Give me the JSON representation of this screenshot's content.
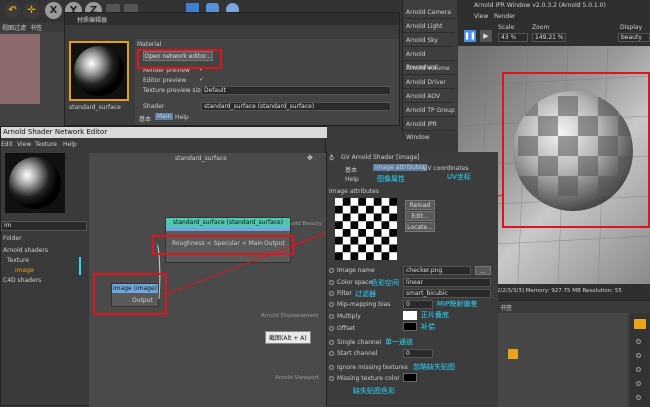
{
  "top_toolbar": {
    "icons": [
      "undo-icon",
      "move-icon",
      "scale-icon",
      "x-axis-icon",
      "y-axis-icon",
      "z-axis-icon",
      "coord-icon"
    ],
    "x_label": "X",
    "y_label": "Y",
    "z_label": "Z"
  },
  "left_menu": {
    "items": [
      "视图",
      "过滤",
      "书签"
    ]
  },
  "material_editor": {
    "title": "材质编辑器",
    "section": "Material",
    "open_network_editor": "Open network editor...",
    "render_preview": "Render preview",
    "editor_preview": "Editor preview",
    "texture_preview_size_label": "Texture preview size",
    "texture_preview_size_value": "Default",
    "material_name": "standard_surface",
    "shader_label": "Shader",
    "shader_value": "standard_surface (standard_surface)",
    "tabs": [
      "基本",
      "Main",
      "Help"
    ]
  },
  "network_editor": {
    "title": "Arnold Shader Network Editor",
    "menus": [
      "Edit",
      "View",
      "Texture",
      "Help"
    ],
    "search_value": "im",
    "list_header": "Folder",
    "tree": [
      "Arnold shaders",
      "Texture",
      "image",
      "C4D shaders"
    ],
    "canvas_title": "standard_surface",
    "node_standard_title": "standard_surface (standard_surface)",
    "node_standard_port_in": "Roughness < Specular < Main",
    "node_standard_port_out": "Output",
    "node_image_title": "image (image)",
    "node_image_port_out": "Output",
    "tooltip": "截图(Alt + A)",
    "side_labels": [
      "Arnold Beauty",
      "Arnold Displacement",
      "Arnold Viewport"
    ]
  },
  "attributes_panel": {
    "title": "GV Arnold Shader [image]",
    "tabs": [
      "基本",
      "Image attributes",
      "UV coordinates",
      "Help"
    ],
    "section": "Image attributes",
    "buttons": [
      "Reload",
      "Edit...",
      "Locate..."
    ],
    "rows": [
      {
        "label": "Image name",
        "value": "checker.png"
      },
      {
        "label": "Color space",
        "value": "linear"
      },
      {
        "label": "Filter",
        "value": "smart_bicubic"
      },
      {
        "label": "Mip-mapping bias",
        "value": "0"
      },
      {
        "label": "Multiply",
        "value": ""
      },
      {
        "label": "Offset",
        "value": ""
      },
      {
        "label": "Single channel",
        "value": ""
      },
      {
        "label": "Start channel",
        "value": "0"
      },
      {
        "label": "Ignore missing textures",
        "value": ""
      },
      {
        "label": "Missing texture color",
        "value": ""
      }
    ],
    "annotations": {
      "image_attrs": "图像属性",
      "uv": "UV坐标",
      "color_space": "色彩空间",
      "filter": "过滤器",
      "mip": "MIP映射偏差",
      "multiply": "正片叠底",
      "offset": "补偿",
      "single_channel": "单一通道",
      "ignore_missing": "忽略缺失贴图",
      "missing_color": "缺失贴图色彩"
    }
  },
  "arnold_menu": {
    "items": [
      "Arnold Camera",
      "Arnold Light",
      "Arnold Sky",
      "Arnold Procedural",
      "Arnold Volume",
      "Arnold Driver",
      "Arnold AOV",
      "Arnold TP Group",
      "Arnold IPR Window"
    ]
  },
  "ipr_window": {
    "title": "Arnold IPR Window v2.0.3.2 (Arnold 5.0.1.0)",
    "menus": [
      "View",
      "Render"
    ],
    "scale_label": "Scale",
    "scale_value": "43 %",
    "zoom_label": "Zoom",
    "zoom_value": "149.21 %",
    "display_label": "Display",
    "display_value": "beauty",
    "status": "Sampling: [3/2/2/3/3/3]  Memory: 927.75 MB  Resolution: 55"
  },
  "bottom_right": {
    "label": "书签"
  },
  "colors": {
    "red_annotation": "#e0141e",
    "cyan_annotation": "#2ad8ff",
    "node_header_green": "#4ec9b0",
    "node_header_blue": "#6fa8dc"
  }
}
